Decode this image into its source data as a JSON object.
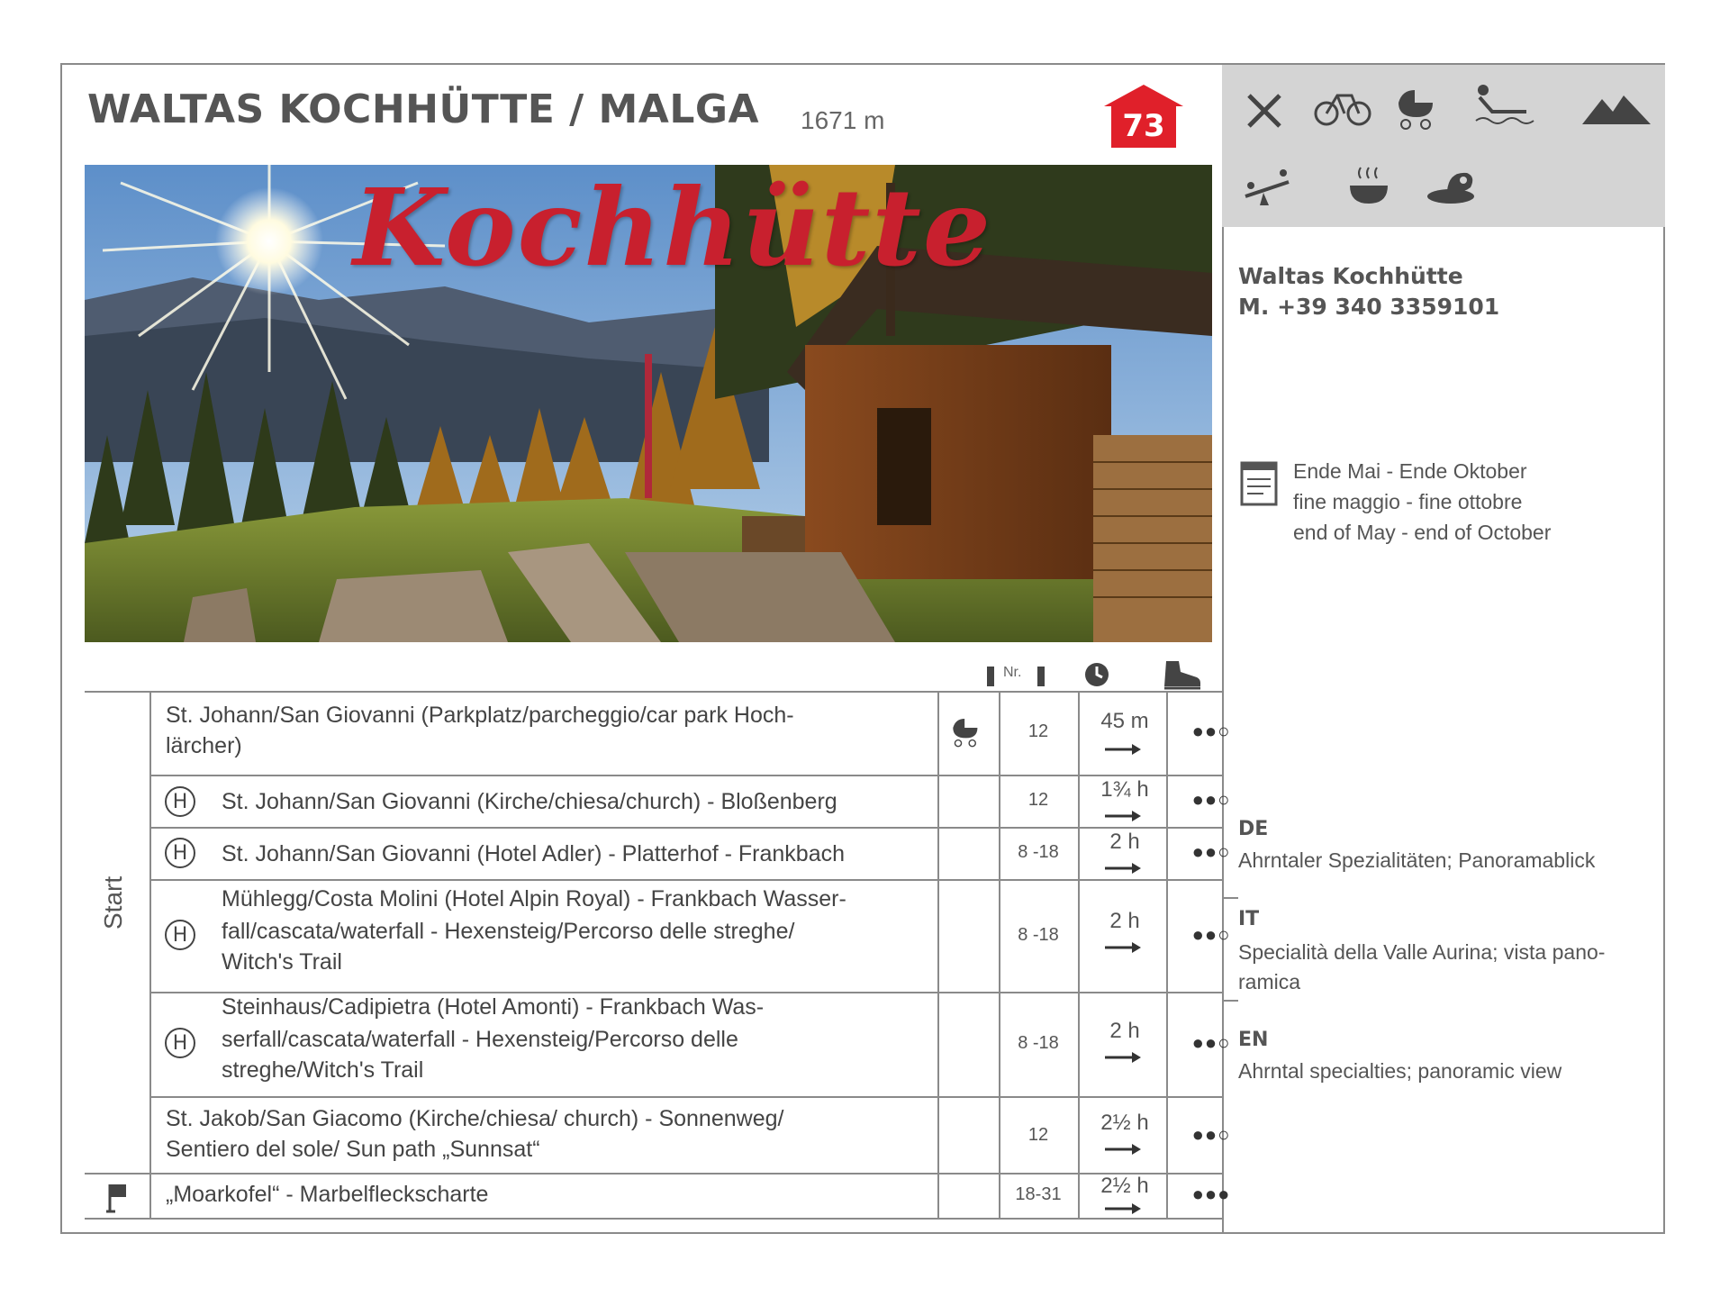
{
  "header": {
    "title": "WALTAS KOCHHÜTTE / MALGA",
    "altitude": "1671 m",
    "badge_number": "73",
    "badge_color": "#e0202a"
  },
  "photo": {
    "script_text": "Kochhütte"
  },
  "amenities": [
    "restaurant-icon",
    "bicycle-icon",
    "stroller-icon",
    "sun-terrace-icon",
    "mountain-view-icon",
    "playground-icon",
    "soup-icon",
    "regional-food-icon"
  ],
  "contact": {
    "name": "Waltas Kochhütte",
    "phone": "M. +39 340 3359101"
  },
  "season": {
    "de": "Ende Mai - Ende Oktober",
    "it": "fine maggio - fine ottobre",
    "en": "end of May - end of October"
  },
  "descriptions": [
    {
      "code": "DE",
      "text": "Ahrntaler Spezialitäten; Panoramablick"
    },
    {
      "code": "IT",
      "text_line1": "Specialità della Valle Aurina; vista pano-",
      "text_line2": "ramica"
    },
    {
      "code": "EN",
      "text": "Ahrntal specialties; panoramic view"
    }
  ],
  "table": {
    "nr_header": "Nr.",
    "start_label": "Start",
    "rows": [
      {
        "lines": [
          "St. Johann/San Giovanni (Parkplatz/parcheggio/car park  Hoch-",
          "lärcher)"
        ],
        "bus": false,
        "stroller": true,
        "nr": "12",
        "time": "45 m",
        "difficulty": "●●○"
      },
      {
        "lines": [
          "St. Johann/San Giovanni (Kirche/chiesa/church) - Bloßenberg"
        ],
        "bus": true,
        "stroller": false,
        "nr": "12",
        "time": "1¾ h",
        "difficulty": "●●○"
      },
      {
        "lines": [
          "St. Johann/San Giovanni (Hotel Adler) - Platterhof - Frankbach"
        ],
        "bus": true,
        "stroller": false,
        "nr": "8 -18",
        "time": "2 h",
        "difficulty": "●●○"
      },
      {
        "lines": [
          "Mühlegg/Costa Molini (Hotel Alpin Royal) - Frankbach Wasser-",
          "fall/cascata/waterfall - Hexensteig/Percorso delle streghe/",
          "Witch's Trail"
        ],
        "bus": true,
        "stroller": false,
        "nr": "8 -18",
        "time": "2 h",
        "difficulty": "●●○"
      },
      {
        "lines": [
          "Steinhaus/Cadipietra (Hotel Amonti) - Frankbach Was-",
          "serfall/cascata/waterfall - Hexensteig/Percorso delle",
          "streghe/Witch's Trail"
        ],
        "bus": true,
        "stroller": false,
        "nr": "8 -18",
        "time": "2 h",
        "difficulty": "●●○"
      },
      {
        "lines": [
          "St. Jakob/San Giacomo (Kirche/chiesa/ church) - Sonnenweg/",
          "Sentiero del sole/ Sun path „Sunnsat“"
        ],
        "bus": false,
        "stroller": false,
        "nr": "12",
        "time": "2½ h",
        "difficulty": "●●○"
      },
      {
        "lines": [
          "„Moarkofel“ - Marbelfleckscharte"
        ],
        "bus": false,
        "stroller": false,
        "nr": "18-31",
        "time": "2½ h",
        "difficulty": "●●●"
      }
    ]
  }
}
